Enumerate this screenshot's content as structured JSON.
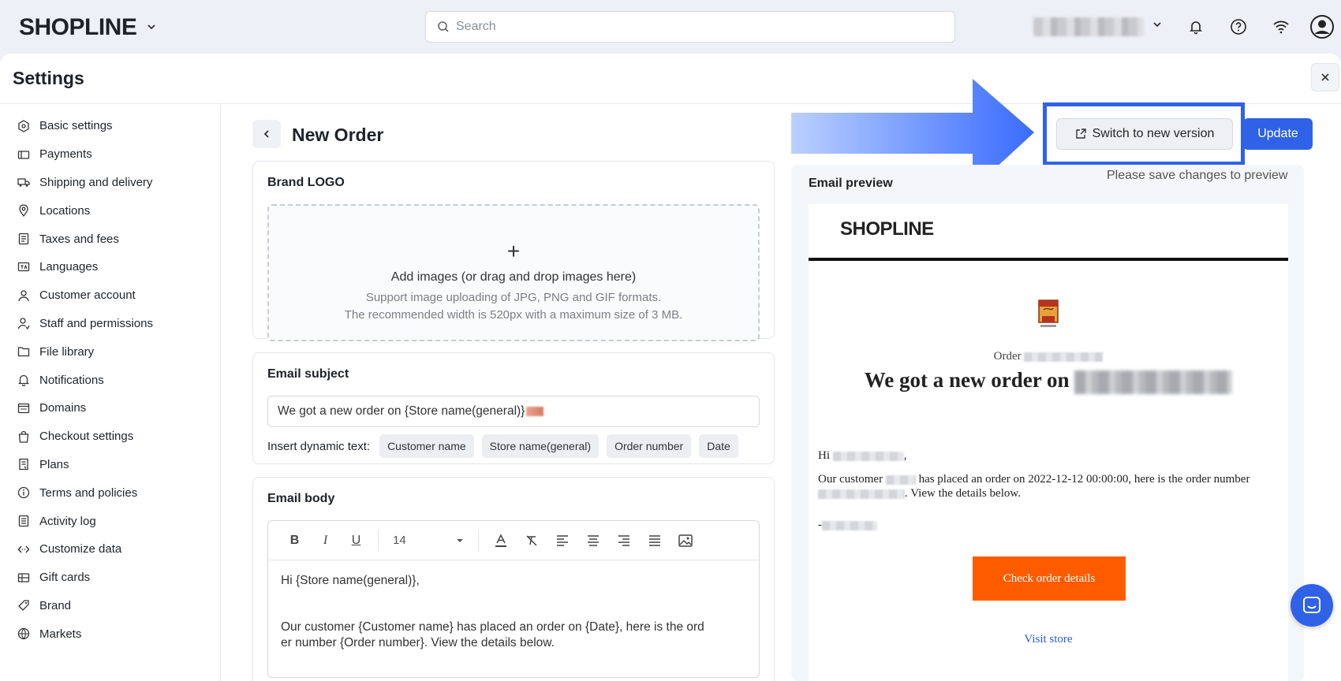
{
  "topbar": {
    "brand": "SHOPLINE",
    "search_placeholder": "Search"
  },
  "settings": {
    "title": "Settings",
    "sidebar": [
      {
        "label": "Basic settings",
        "icon": "basic-settings-icon"
      },
      {
        "label": "Payments",
        "icon": "payments-icon"
      },
      {
        "label": "Shipping and delivery",
        "icon": "truck-icon"
      },
      {
        "label": "Locations",
        "icon": "location-pin-icon"
      },
      {
        "label": "Taxes and fees",
        "icon": "tax-icon"
      },
      {
        "label": "Languages",
        "icon": "language-icon"
      },
      {
        "label": "Customer account",
        "icon": "user-icon"
      },
      {
        "label": "Staff and permissions",
        "icon": "staff-icon"
      },
      {
        "label": "File library",
        "icon": "folder-icon"
      },
      {
        "label": "Notifications",
        "icon": "bell-icon"
      },
      {
        "label": "Domains",
        "icon": "domain-icon"
      },
      {
        "label": "Checkout settings",
        "icon": "bag-icon"
      },
      {
        "label": "Plans",
        "icon": "plans-icon"
      },
      {
        "label": "Terms and policies",
        "icon": "info-icon"
      },
      {
        "label": "Activity log",
        "icon": "log-icon"
      },
      {
        "label": "Customize data",
        "icon": "code-icon"
      },
      {
        "label": "Gift cards",
        "icon": "gift-card-icon"
      },
      {
        "label": "Brand",
        "icon": "brand-icon"
      },
      {
        "label": "Markets",
        "icon": "globe-icon"
      }
    ]
  },
  "page": {
    "title": "New Order",
    "switch_button": "Switch to new version",
    "update_button": "Update",
    "save_hint": "Please save changes to preview"
  },
  "brand_logo": {
    "title": "Brand LOGO",
    "plus": "+",
    "upload_main": "Add images (or drag and drop images here)",
    "upload_formats": "Support image uploading of JPG, PNG and GIF formats.",
    "upload_size": "The recommended width is 520px with a maximum size of 3 MB."
  },
  "email_subject": {
    "title": "Email subject",
    "value": "We got a new order on {Store name(general)}",
    "dynamic_label": "Insert dynamic text:",
    "chips": [
      "Customer name",
      "Store name(general)",
      "Order number",
      "Date"
    ]
  },
  "email_body": {
    "title": "Email body",
    "font_size": "14",
    "line1": "Hi {Store name(general)},",
    "line2": "Our customer {Customer name} has placed an order on {Date}, here is the ord",
    "line3": "er number {Order number}. View the details below."
  },
  "preview": {
    "title": "Email preview",
    "brand": "SHOPLINE",
    "order_label": "Order",
    "headline": "We got a new order on",
    "hi": "Hi",
    "body_a": "Our customer",
    "body_b": "has placed an order on 2022-12-12 00:00:00, here is the order number",
    "body_c": ". View the details below.",
    "sign": "-",
    "cta": "Check order details",
    "visit": "Visit store"
  },
  "colors": {
    "accent": "#2f62e6",
    "cta": "#ff5c00",
    "link": "#2a5bd7"
  }
}
